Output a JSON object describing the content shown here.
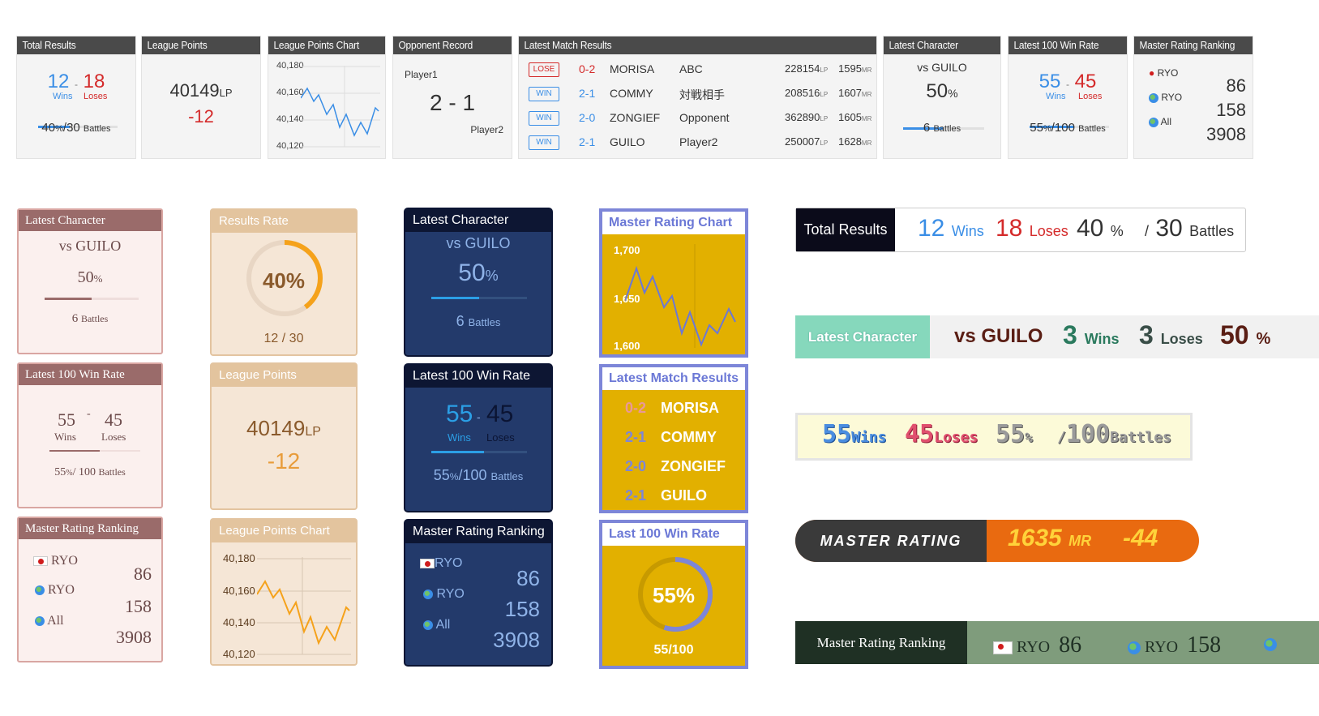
{
  "grey": {
    "total": {
      "header": "Total Results",
      "wins": "12",
      "dash": "-",
      "loses": "18",
      "wins_label": "Wins",
      "loses_label": "Loses",
      "rate": "40",
      "pct": "%",
      "slash": "/",
      "battles": "30",
      "battles_label": "Battles"
    },
    "lp": {
      "header": "League Points",
      "value": "40149",
      "unit": "LP",
      "delta": "-12"
    },
    "lpchart": {
      "header": "League Points Chart",
      "ticks": [
        "40,180",
        "40,160",
        "40,140",
        "40,120"
      ]
    },
    "opp": {
      "header": "Opponent Record",
      "p1": "Player1",
      "score": "2 - 1",
      "p2": "Player2"
    },
    "matches": {
      "header": "Latest Match Results",
      "rows": [
        {
          "tag": "LOSE",
          "score": "0-2",
          "char": "MORISA",
          "opp": "ABC",
          "lp": "228154",
          "lpu": "LP",
          "mr": "1595",
          "mru": "MR"
        },
        {
          "tag": "WIN",
          "score": "2-1",
          "char": "COMMY",
          "opp": "対戦相手",
          "lp": "208516",
          "lpu": "LP",
          "mr": "1607",
          "mru": "MR"
        },
        {
          "tag": "WIN",
          "score": "2-0",
          "char": "ZONGIEF",
          "opp": "Opponent",
          "lp": "362890",
          "lpu": "LP",
          "mr": "1605",
          "mru": "MR"
        },
        {
          "tag": "WIN",
          "score": "2-1",
          "char": "GUILO",
          "opp": "Player2",
          "lp": "250007",
          "lpu": "LP",
          "mr": "1628",
          "mru": "MR"
        }
      ]
    },
    "lastchar": {
      "header": "Latest Character",
      "vs": "vs GUILO",
      "rate": "50",
      "pct": "%",
      "battles": "6",
      "battles_label": "Battles"
    },
    "winrate": {
      "header": "Latest 100 Win Rate",
      "wins": "55",
      "dash": "-",
      "loses": "45",
      "wins_label": "Wins",
      "loses_label": "Loses",
      "rate": "55",
      "pct": "%",
      "slash": "/",
      "battles": "100",
      "battles_label": "Battles"
    },
    "mrr": {
      "header": "Master Rating Ranking",
      "rows": [
        {
          "name": "RYO",
          "val": "86"
        },
        {
          "name": "RYO",
          "val": "158"
        },
        {
          "name": "All",
          "val": "3908"
        }
      ]
    }
  },
  "pink": {
    "lastchar": {
      "header": "Latest Character",
      "vs": "vs GUILO",
      "rate": "50",
      "pct": "%",
      "battles": "6",
      "battles_label": "Battles"
    },
    "winrate": {
      "header": "Latest 100 Win Rate",
      "wins": "55",
      "dash": "-",
      "loses": "45",
      "wins_label": "Wins",
      "loses_label": "Loses",
      "rate": "55",
      "pct": "%",
      "slash": "/",
      "battles": "100",
      "battles_label": "Battles"
    },
    "mrr": {
      "header": "Master Rating Ranking",
      "rows": [
        {
          "name": "RYO",
          "val": "86"
        },
        {
          "name": "RYO",
          "val": "158"
        },
        {
          "name": "All",
          "val": "3908"
        }
      ]
    }
  },
  "tan": {
    "results": {
      "header": "Results Rate",
      "rate": "40%",
      "frac": "12 / 30",
      "progress": 0.4
    },
    "lp": {
      "header": "League Points",
      "value": "40149",
      "unit": "LP",
      "delta": "-12"
    },
    "lpchart": {
      "header": "League Points Chart",
      "ticks": [
        "40,180",
        "40,160",
        "40,140",
        "40,120"
      ]
    }
  },
  "navy": {
    "lastchar": {
      "header": "Latest Character",
      "vs": "vs GUILO",
      "rate": "50",
      "pct": "%",
      "battles": "6",
      "battles_label": "Battles"
    },
    "winrate": {
      "header": "Latest 100 Win Rate",
      "wins": "55",
      "dash": "-",
      "loses": "45",
      "wins_label": "Wins",
      "loses_label": "Loses",
      "rate": "55",
      "pct": "%",
      "slash": "/",
      "battles": "100",
      "battles_label": "Battles"
    },
    "mrr": {
      "header": "Master Rating Ranking",
      "rows": [
        {
          "name": "RYO",
          "val": "86"
        },
        {
          "name": "RYO",
          "val": "158"
        },
        {
          "name": "All",
          "val": "3908"
        }
      ]
    }
  },
  "yellow": {
    "mrchart": {
      "header": "Master Rating Chart",
      "ticks": [
        "1,700",
        "1,650",
        "1,600"
      ]
    },
    "matches": {
      "header": "Latest Match Results",
      "rows": [
        {
          "score": "0-2",
          "char": "MORISA"
        },
        {
          "score": "2-1",
          "char": "COMMY"
        },
        {
          "score": "2-0",
          "char": "ZONGIEF"
        },
        {
          "score": "2-1",
          "char": "GUILO"
        }
      ]
    },
    "winrate": {
      "header": "Last 100 Win Rate",
      "rate": "55%",
      "frac": "55/100",
      "progress": 0.55
    }
  },
  "banners": {
    "total": {
      "label": "Total Results",
      "wins": "12",
      "wins_label": "Wins",
      "loses": "18",
      "loses_label": "Loses",
      "rate": "40",
      "pct": "%",
      "slash": "/",
      "battles": "30",
      "battles_label": "Battles"
    },
    "lastchar": {
      "label": "Latest Character",
      "vs": "vs GUILO",
      "wins": "3",
      "wins_label": "Wins",
      "loses": "3",
      "loses_label": "Loses",
      "rate": "50",
      "pct": "%"
    },
    "pixel": {
      "wins": "55",
      "wins_label": "Wins",
      "loses": "45",
      "loses_label": "Loses",
      "rate": "55",
      "pct": "%",
      "slash": "/",
      "battles": "100",
      "battles_label": "Battles"
    },
    "mr": {
      "label": "MASTER RATING",
      "value": "1635",
      "unit": "MR",
      "delta": "-44"
    },
    "mrr": {
      "label": "Master Rating Ranking",
      "r1": "RYO",
      "v1": "86",
      "r2": "RYO",
      "v2": "158"
    }
  },
  "colors": {
    "blue": "#3a8ee6",
    "red": "#d42a2a",
    "tanOrange": "#f5a21b",
    "navyBlue": "#2b9fe6",
    "ring": "#7d86d8"
  }
}
